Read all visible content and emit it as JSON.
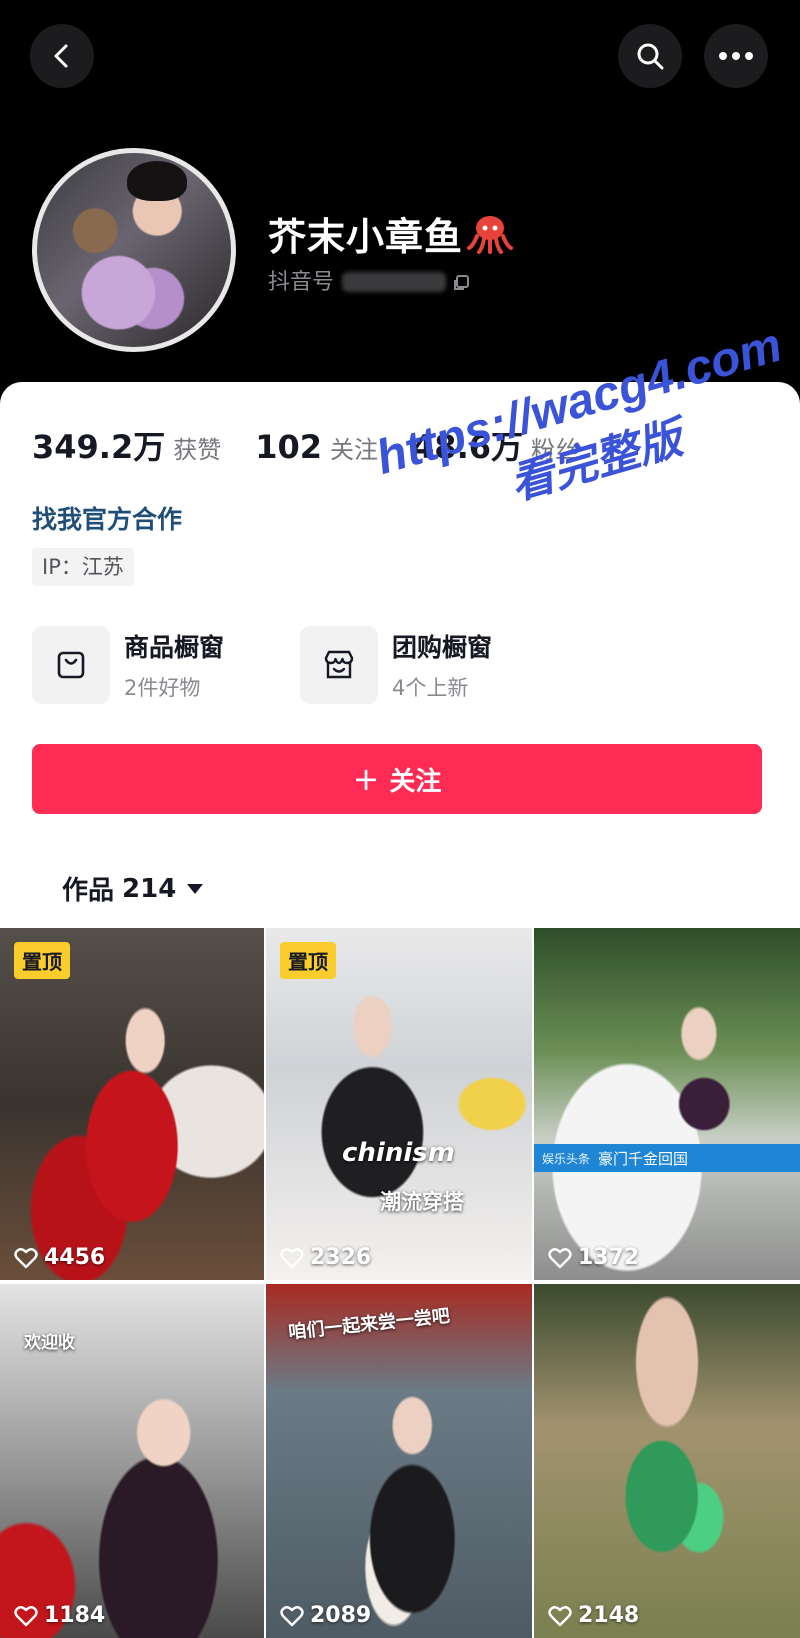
{
  "header": {
    "nickname": "芥末小章鱼",
    "douyin_id_label": "抖音号"
  },
  "stats": [
    {
      "value": "349.2万",
      "label": "获赞"
    },
    {
      "value": "102",
      "label": "关注"
    },
    {
      "value": "48.6万",
      "label": "粉丝"
    }
  ],
  "cooperation_link": "找我官方合作",
  "ip_location": "IP：江苏",
  "shops": [
    {
      "title": "商品橱窗",
      "subtitle": "2件好物",
      "icon": "bag-icon"
    },
    {
      "title": "团购橱窗",
      "subtitle": "4个上新",
      "icon": "store-icon"
    }
  ],
  "follow_button": {
    "plus": "+",
    "label": "关注"
  },
  "works_tab": {
    "label": "作品",
    "count": "214"
  },
  "watermark": {
    "line1": "https://wacg4.com",
    "line2": "看完整版"
  },
  "videos": [
    {
      "likes": "4456",
      "pinned": "置顶"
    },
    {
      "likes": "2326",
      "pinned": "置顶",
      "overlay_brand": "chinism",
      "overlay_caption": "潮流穿搭"
    },
    {
      "likes": "1372",
      "banner_left": "娱乐头条",
      "banner_right": "豪门千金回国"
    },
    {
      "likes": "1184",
      "overlay_caption": "欢迎收"
    },
    {
      "likes": "2089",
      "overlay_caption": "咱们一起来尝一尝吧"
    },
    {
      "likes": "2148"
    }
  ],
  "colors": {
    "accent": "#fe2c55",
    "pin_badge": "#facc2c",
    "link": "#1f4e79",
    "watermark": "#3a53d8"
  }
}
